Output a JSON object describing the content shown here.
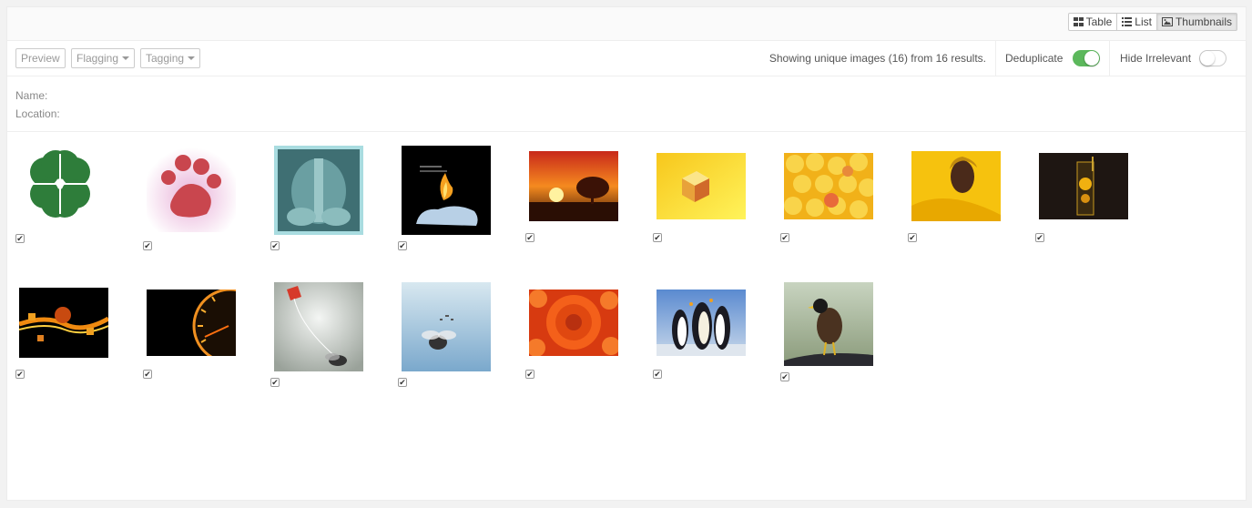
{
  "view_toggle": {
    "table_label": "Table",
    "list_label": "List",
    "thumbnails_label": "Thumbnails",
    "active": "Thumbnails"
  },
  "toolbar": {
    "preview_label": "Preview",
    "flagging_label": "Flagging",
    "tagging_label": "Tagging",
    "status_text": "Showing unique images (16) from 16 results.",
    "deduplicate_label": "Deduplicate",
    "deduplicate_on": true,
    "hide_irrelevant_label": "Hide Irrelevant",
    "hide_irrelevant_on": false
  },
  "meta": {
    "name_label": "Name:",
    "location_label": "Location:"
  },
  "thumbnails": [
    {
      "subject": "four-leaf-clover",
      "checked": true
    },
    {
      "subject": "red-paw-print",
      "checked": true
    },
    {
      "subject": "x-ray",
      "checked": true
    },
    {
      "subject": "flame-on-ice",
      "checked": true
    },
    {
      "subject": "sunset-tree",
      "checked": true
    },
    {
      "subject": "yellow-cube",
      "checked": true
    },
    {
      "subject": "yellow-petals",
      "checked": true
    },
    {
      "subject": "woman-yellow-fabric",
      "checked": true
    },
    {
      "subject": "lemon-glass",
      "checked": true
    },
    {
      "subject": "fire-figure",
      "checked": true
    },
    {
      "subject": "speedometer",
      "checked": true
    },
    {
      "subject": "kite-fly",
      "checked": true
    },
    {
      "subject": "fly-sky",
      "checked": true
    },
    {
      "subject": "orange-flower",
      "checked": true
    },
    {
      "subject": "penguins",
      "checked": true
    },
    {
      "subject": "myna-bird",
      "checked": true
    }
  ],
  "colors": {
    "toggle_on": "#5cb85c",
    "border": "#cccccc",
    "text": "#555555"
  }
}
